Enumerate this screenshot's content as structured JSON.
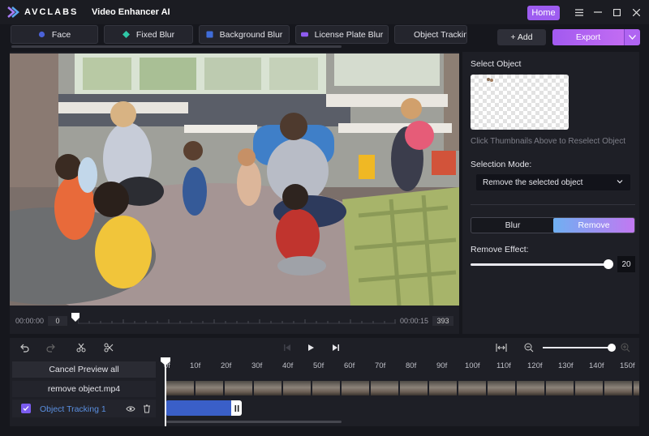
{
  "titlebar": {
    "brand": "AVCLABS",
    "app_title": "Video Enhancer AI",
    "home_label": "Home"
  },
  "tabs": [
    {
      "label": "Face",
      "icon": "face-icon"
    },
    {
      "label": "Fixed Blur",
      "icon": "fixed-blur-icon"
    },
    {
      "label": "Background Blur",
      "icon": "background-blur-icon"
    },
    {
      "label": "License Plate Blur",
      "icon": "license-plate-icon"
    },
    {
      "label": "Object Trackin",
      "icon": "object-tracking-icon"
    }
  ],
  "actions": {
    "add_label": "+ Add",
    "export_label": "Export"
  },
  "preview": {
    "time_start": "00:00:00",
    "frame_start": "0",
    "time_end": "00:00:15",
    "frame_end": "393"
  },
  "right_panel": {
    "select_object_label": "Select Object",
    "hint": "Click Thumbnails Above to Reselect Object",
    "selection_mode_label": "Selection Mode:",
    "selection_mode_value": "Remove the selected object",
    "mode_blur": "Blur",
    "mode_remove": "Remove",
    "remove_effect_label": "Remove Effect:",
    "remove_effect_value": "20",
    "remove_effect_fraction": 0.98
  },
  "timeline": {
    "cancel_preview_label": "Cancel Preview all",
    "file_name": "remove object.mp4",
    "track_name": "Object Tracking 1",
    "ruler": [
      "0f",
      "10f",
      "20f",
      "30f",
      "40f",
      "50f",
      "60f",
      "70f",
      "80f",
      "90f",
      "100f",
      "110f",
      "120f",
      "130f",
      "140f",
      "150f"
    ]
  },
  "colors": {
    "accent_purple": "#9d5cf0",
    "remove_gradient_start": "#6fb0f2",
    "remove_gradient_end": "#c278f2",
    "track_blue": "#3a5fc8"
  }
}
